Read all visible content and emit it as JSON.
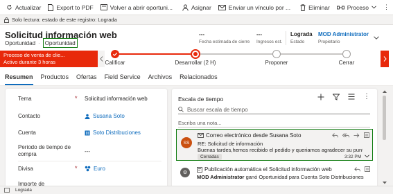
{
  "toolbar": {
    "items": [
      {
        "label": "Actualizar",
        "icon": "refresh-icon"
      },
      {
        "label": "Export to PDF",
        "icon": "pdf-icon"
      },
      {
        "label": "Volver a abrir oportuni...",
        "icon": "reopen-icon"
      },
      {
        "label": "Asignar",
        "icon": "assign-icon"
      },
      {
        "label": "Enviar un vínculo por ...",
        "icon": "email-link-icon"
      },
      {
        "label": "Eliminar",
        "icon": "delete-icon"
      },
      {
        "label": "Proceso",
        "icon": "process-icon"
      }
    ]
  },
  "readonly_notice": "Solo lectura: estado de este registro: Lograda",
  "record": {
    "title": "Solicitud información web",
    "entity": "Oportunidad",
    "form": "Oportunidad",
    "fields": [
      {
        "value": "---",
        "label": "Fecha estimada de cierre"
      },
      {
        "value": "---",
        "label": "Ingresos est."
      },
      {
        "value": "Lograda",
        "label": "Estado"
      },
      {
        "value": "MOD Administrator",
        "label": "Propietario"
      }
    ]
  },
  "process": {
    "name": "Proceso de venta de clie...",
    "duration": "Activo durante 3 horas",
    "stages": [
      {
        "label": "Calificar"
      },
      {
        "label": "Desarrollar  (2 H)"
      },
      {
        "label": "Proponer"
      },
      {
        "label": "Cerrar"
      }
    ]
  },
  "tabs": [
    "Resumen",
    "Productos",
    "Ofertas",
    "Field Service",
    "Archivos",
    "Relacionados"
  ],
  "form_fields": [
    {
      "label": "Tema",
      "required": "*",
      "value": "Solicitud información web"
    },
    {
      "label": "Contacto",
      "required": "",
      "value": "Susana Soto"
    },
    {
      "label": "Cuenta",
      "required": "",
      "value": "Soto Distribuciones"
    },
    {
      "label": "Periodo de tiempo de compra",
      "required": "",
      "value": "---"
    },
    {
      "label": "Divisa",
      "required": "*",
      "value": "Euro"
    },
    {
      "label": "Importe de",
      "required": "",
      "value": ""
    }
  ],
  "timeline": {
    "title": "Escala de tiempo",
    "search_placeholder": "Buscar escala de tiempo",
    "note_placeholder": "Escriba una nota...",
    "email": {
      "avatar": "SS",
      "header": "Correo electrónico desde Susana Soto",
      "subject": "RE: Solicitud de información",
      "body": "Buenas tardes,hemos recibido el pedido y queriamos agradecer su puntu...",
      "status": "Cerradas",
      "time": "3:32 PM"
    },
    "post": {
      "header": "Publicación automática el Solicitud información web",
      "author": "MOD Administrator",
      "body": " ganó Oportunidad para Cuenta Soto Distribuciones"
    }
  },
  "status_bar": "Lograda",
  "colors": {
    "accent": "#0f6cbd",
    "process_red": "#e8290b",
    "highlight": "#107c10"
  }
}
